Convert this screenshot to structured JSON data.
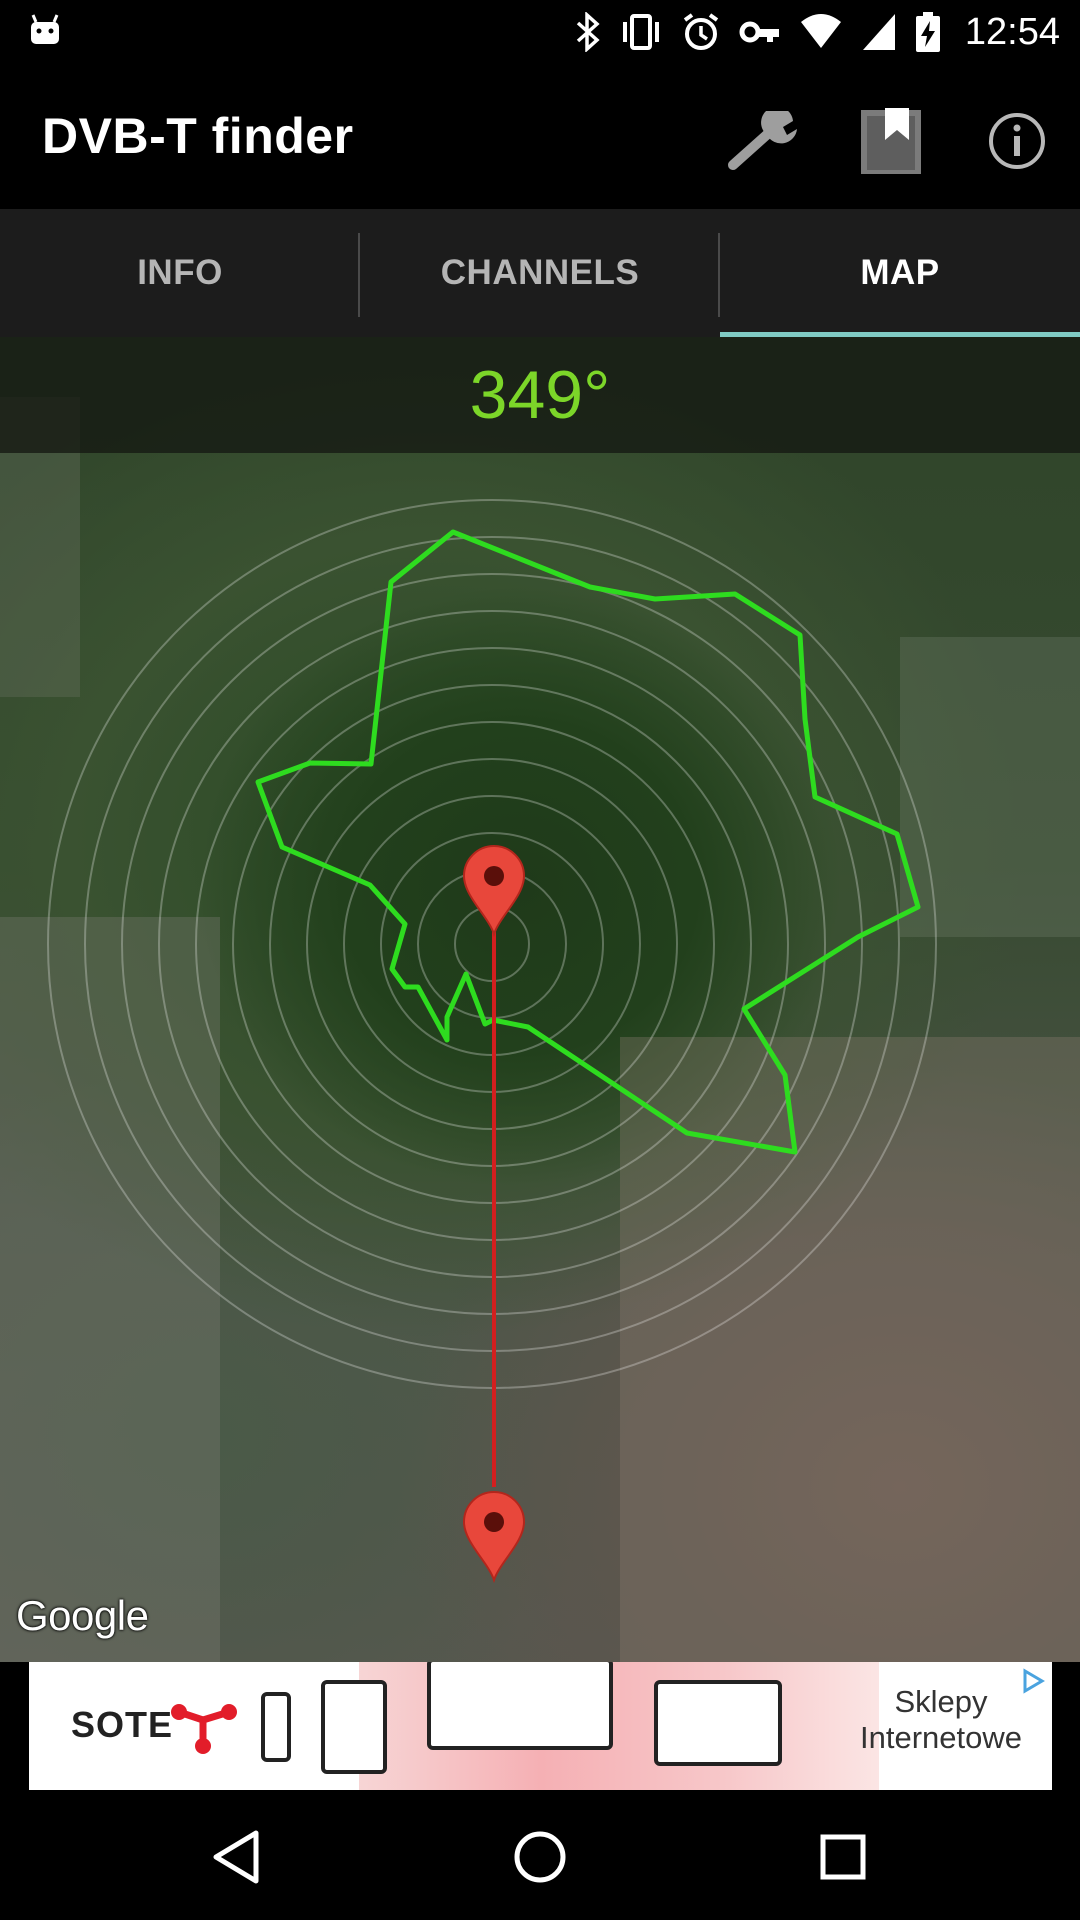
{
  "status_bar": {
    "time": "12:54",
    "icons": [
      "android-notification-icon",
      "bluetooth-icon",
      "vibrate-icon",
      "alarm-icon",
      "vpn-key-icon",
      "wifi-icon",
      "signal-icon",
      "battery-charging-icon"
    ]
  },
  "app_bar": {
    "title": "DVB-T finder",
    "actions": [
      "wrench-settings-icon",
      "bookmark-icon",
      "info-icon"
    ]
  },
  "tabs": [
    {
      "label": "INFO",
      "active": false
    },
    {
      "label": "CHANNELS",
      "active": false
    },
    {
      "label": "MAP",
      "active": true
    }
  ],
  "map": {
    "bearing": "349°",
    "attribution": "Google",
    "colors": {
      "coverage_outline": "#2edc1f",
      "line": "#d31f1f",
      "marker": "#e8473b",
      "bearing_text": "#7cd629"
    }
  },
  "ad": {
    "brand": "SOTE",
    "text_line1": "Sklepy",
    "text_line2": "Internetowe",
    "icon": "ad-choices-icon"
  },
  "nav_bar": {
    "buttons": [
      "back-icon",
      "home-icon",
      "recents-icon"
    ]
  },
  "colors": {
    "accent": "#80cbc4",
    "tab_bg": "#1c1c1c"
  }
}
